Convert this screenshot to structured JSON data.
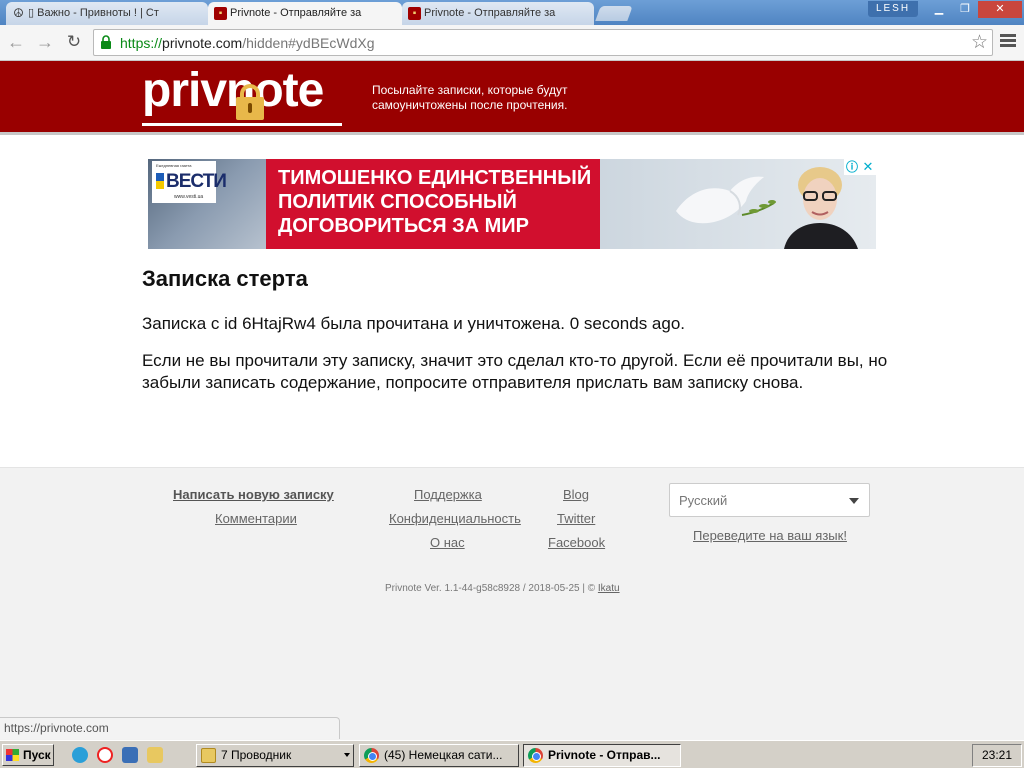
{
  "browser": {
    "tabs": [
      {
        "title": "▯ Важно - Привноты ! | Ст"
      },
      {
        "title": "Privnote - Отправляйте за"
      },
      {
        "title": "Privnote - Отправляйте за"
      }
    ],
    "user_badge": "LESH",
    "address": {
      "scheme": "https://",
      "host": "privnote.com",
      "path": "/hidden#ydBEcWdXg"
    },
    "status_url": "https://privnote.com"
  },
  "header": {
    "logo": "privnote",
    "tagline": "Посылайте записки, которые будут самоуничтожены после прочтения."
  },
  "ad": {
    "brand": "ВЕСТИ",
    "brand_tag": "Ежедневная газета",
    "brand_url": "www.vesti.ua",
    "headline": "ТИМОШЕНКО ЕДИНСТВЕННЫЙ\nПОЛИТИК СПОСОБНЫЙ\nДОГОВОРИТЬСЯ ЗА МИР",
    "info_icon": "ⓘ",
    "close_icon": "✕"
  },
  "note": {
    "title": "Записка стерта",
    "line1": "Записка с id 6HtajRw4 была прочитана и уничтожена. 0 seconds ago.",
    "line2": "Если не вы прочитали эту записку, значит это сделал кто-то другой. Если её прочитали вы, но забыли записать содержание, попросите отправителя прислать вам записку снова."
  },
  "footer": {
    "links_col1": [
      "Написать новую записку",
      "Комментарии"
    ],
    "links_col2": [
      "Поддержка",
      "Конфиденциальность",
      "О нас"
    ],
    "links_col3": [
      "Blog",
      "Twitter",
      "Facebook"
    ],
    "language_value": "Русский",
    "translate_link": "Переведите на ваш язык!",
    "version_text": "Privnote Ver. 1.1-44-g58c8928 / 2018-05-25 | © ",
    "version_link": "Ikatu"
  },
  "taskbar": {
    "start_label": "Пуск",
    "tasks": [
      {
        "label": "7 Проводник"
      },
      {
        "label": "(45) Немецкая сати..."
      },
      {
        "label": "Privnote - Отправ..."
      }
    ],
    "clock": "23:21"
  },
  "colors": {
    "brand_red": "#990000",
    "ad_red": "#d10f2e",
    "url_green": "#0a8a17"
  }
}
